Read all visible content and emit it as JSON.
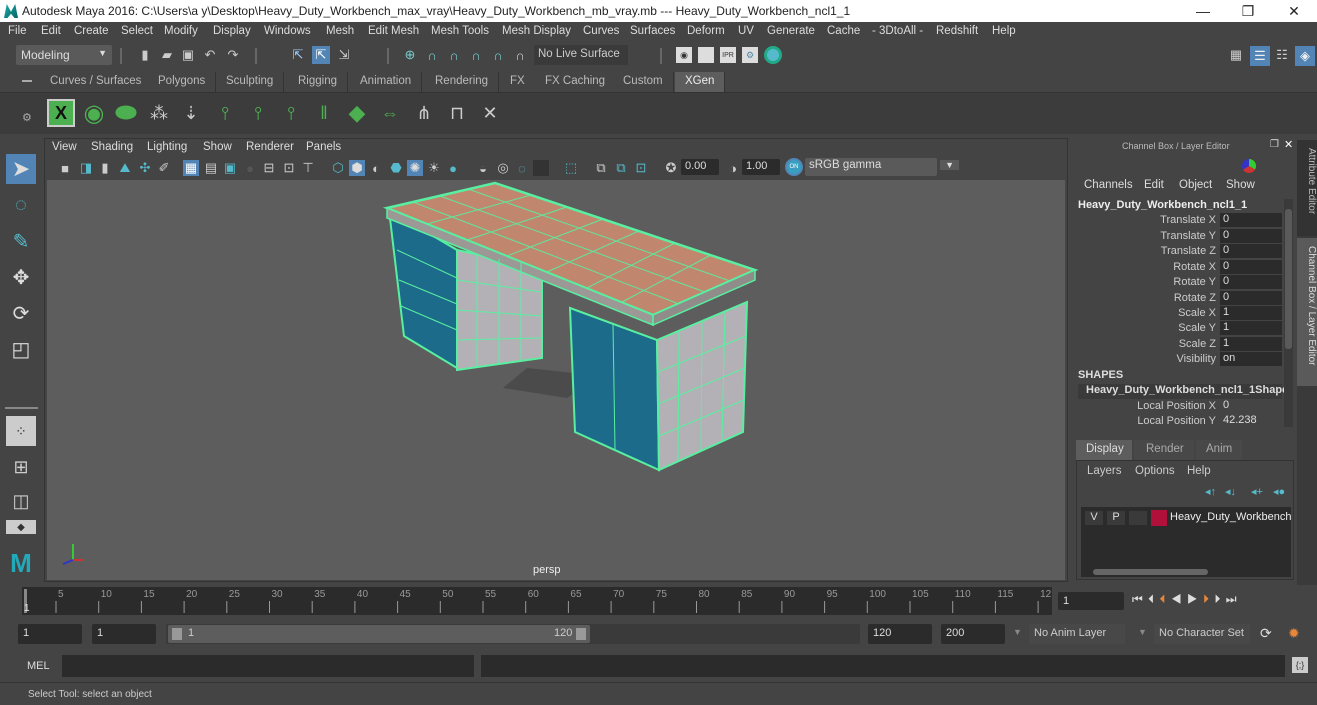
{
  "window": {
    "title": "Autodesk Maya 2016: C:\\Users\\a y\\Desktop\\Heavy_Duty_Workbench_max_vray\\Heavy_Duty_Workbench_mb_vray.mb  ---  Heavy_Duty_Workbench_ncl1_1",
    "minimize": "—",
    "maximize": "❐",
    "close": "✕"
  },
  "menubar": [
    "File",
    "Edit",
    "Create",
    "Select",
    "Modify",
    "Display",
    "Windows",
    "Mesh",
    "Edit Mesh",
    "Mesh Tools",
    "Mesh Display",
    "Curves",
    "Surfaces",
    "Deform",
    "UV",
    "Generate",
    "Cache",
    "- 3DtoAll -",
    "Redshift",
    "Help"
  ],
  "statusline": {
    "mode": "Modeling",
    "live_surface": "No Live Surface"
  },
  "shelf": {
    "tabs": [
      "Curves / Surfaces",
      "Polygons",
      "Sculpting",
      "Rigging",
      "Animation",
      "Rendering",
      "FX",
      "FX Caching",
      "Custom",
      "XGen"
    ],
    "active_tab": "XGen",
    "icons": [
      "xgen-editor-icon",
      "xgen-preview-icon",
      "xgen-clear-preview-icon",
      "add-guides-icon",
      "place-guides-icon",
      "add-guide-icon",
      "guide-visibility-icon",
      "lock-guide-icon",
      "guide-sculpt-icon",
      "create-patch-icon",
      "guide-length-icon",
      "select-guides-icon",
      "guide-bounds-icon",
      "delete-guide-icon"
    ]
  },
  "viewport": {
    "menus": [
      "View",
      "Shading",
      "Lighting",
      "Show",
      "Renderer",
      "Panels"
    ],
    "exposure": "0.00",
    "gamma": "1.00",
    "color_space": "sRGB gamma",
    "camera_label": "persp",
    "axis": {
      "x": "x",
      "y": "y",
      "z": "z"
    }
  },
  "channel_box": {
    "title": "Channel Box / Layer Editor",
    "menus": [
      "Channels",
      "Edit",
      "Object",
      "Show"
    ],
    "object_name": "Heavy_Duty_Workbench_ncl1_1",
    "channels": [
      {
        "label": "Translate X",
        "value": "0"
      },
      {
        "label": "Translate Y",
        "value": "0"
      },
      {
        "label": "Translate Z",
        "value": "0"
      },
      {
        "label": "Rotate X",
        "value": "0"
      },
      {
        "label": "Rotate Y",
        "value": "0"
      },
      {
        "label": "Rotate Z",
        "value": "0"
      },
      {
        "label": "Scale X",
        "value": "1"
      },
      {
        "label": "Scale Y",
        "value": "1"
      },
      {
        "label": "Scale Z",
        "value": "1"
      },
      {
        "label": "Visibility",
        "value": "on"
      }
    ],
    "shapes_header": "SHAPES",
    "shape_name": "Heavy_Duty_Workbench_ncl1_1Shape",
    "shape_channels": [
      {
        "label": "Local Position X",
        "value": "0"
      },
      {
        "label": "Local Position Y",
        "value": "42.238"
      }
    ]
  },
  "layer_editor": {
    "tabs": [
      "Display",
      "Render",
      "Anim"
    ],
    "active_tab": "Display",
    "menus": [
      "Layers",
      "Options",
      "Help"
    ],
    "layers": [
      {
        "v": "V",
        "p": "P",
        "color": "#b0103a",
        "name": "Heavy_Duty_Workbench"
      }
    ]
  },
  "side_tabs": [
    "Attribute Editor",
    "Channel Box / Layer Editor"
  ],
  "timeline": {
    "ticks": [
      "5",
      "10",
      "15",
      "20",
      "25",
      "30",
      "35",
      "40",
      "45",
      "50",
      "55",
      "60",
      "65",
      "70",
      "75",
      "80",
      "85",
      "90",
      "95",
      "100",
      "105",
      "110",
      "115",
      "12"
    ],
    "current_frame_marker": "1",
    "current_frame": "1"
  },
  "range": {
    "start": "1",
    "playback_start": "1",
    "slider_start": "1",
    "slider_end": "120",
    "playback_end": "120",
    "end": "200",
    "anim_layer": "No Anim Layer",
    "character_set": "No Character Set"
  },
  "command_line": {
    "language": "MEL"
  },
  "help_line": "Select Tool: select an object",
  "colors": {
    "accent_blue": "#5285b6",
    "wireframe_green": "#58f0a0",
    "layer_color": "#b0103a"
  }
}
